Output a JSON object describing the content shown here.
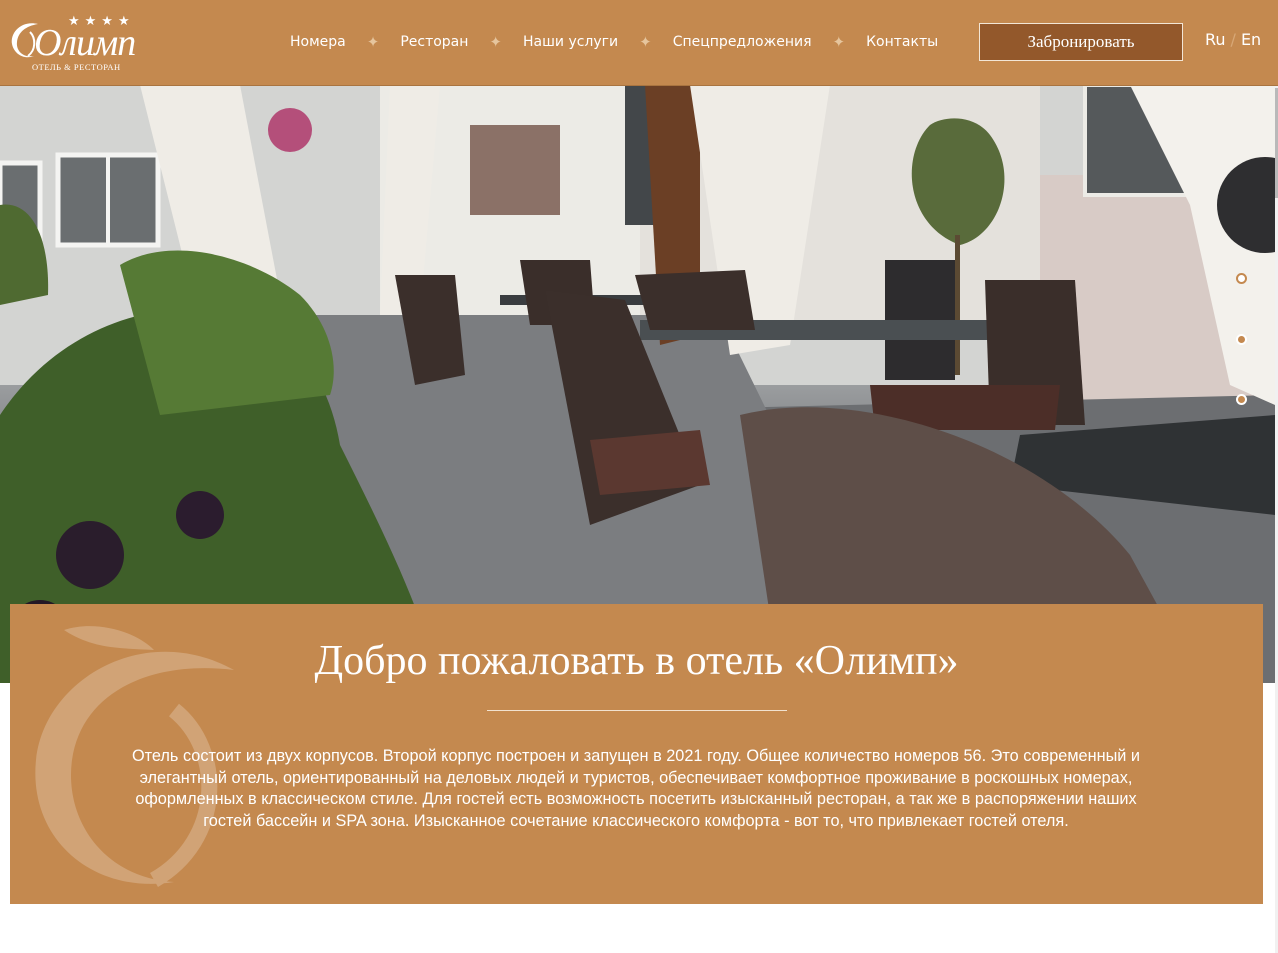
{
  "header": {
    "logo": {
      "stars": "★★★★",
      "wordmark": "Олимп",
      "tagline": "ОТЕЛЬ & РЕСТОРАН"
    },
    "nav": [
      {
        "label": "Номера"
      },
      {
        "label": "Ресторан"
      },
      {
        "label": "Наши услуги"
      },
      {
        "label": "Спецпредложения"
      },
      {
        "label": "Контакты"
      }
    ],
    "nav_separator": "✦",
    "book_label": "Забронировать",
    "lang": {
      "ru": "Ru",
      "sep": "/",
      "en": "En"
    }
  },
  "slider": {
    "dots": [
      {
        "state": "active"
      },
      {
        "state": "inactive"
      },
      {
        "state": "inactive"
      }
    ]
  },
  "welcome": {
    "title": "Добро пожаловать в отель «Олимп»",
    "text": "Отель состоит из двух корпусов. Второй корпус построен и запущен в 2021 году. Общее количество номеров 56. Это современный и элегантный отель, ориентированный на деловых людей и туристов, обеспечивает комфортное проживание в роскошных номерах, оформленных в классическом стиле. Для гостей есть возможность посетить изысканный ресторан, а так же в распоряжении наших гостей бассейн и SPA зона. Изысканное сочетание классического комфорта - вот то, что привлекает гостей отеля."
  },
  "colors": {
    "brand": "#c4894f",
    "button": "#93582b",
    "white": "#ffffff",
    "dot_active_fill": "#ffffff",
    "dot_inactive_fill": "#c4894f"
  },
  "icons": {
    "nav_separator": "star-ornament-icon",
    "slider_dot": "slider-dot-icon"
  }
}
